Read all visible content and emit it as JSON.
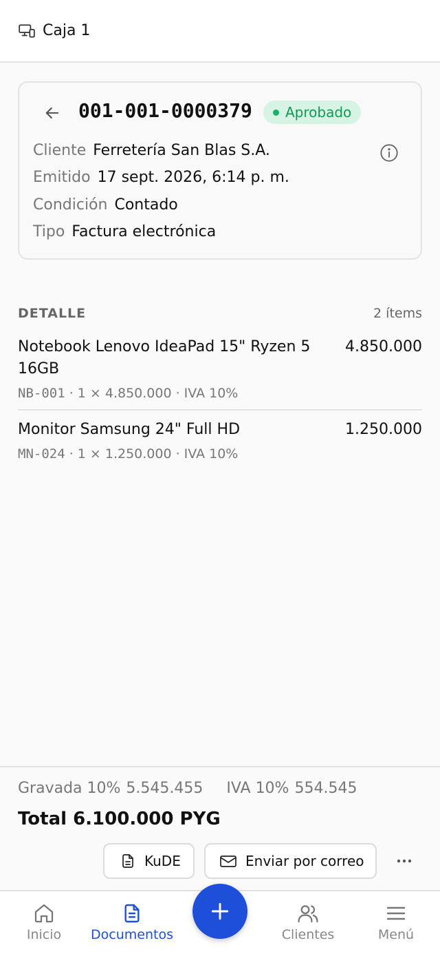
{
  "header": {
    "title": "Caja 1",
    "icon": "devices-icon"
  },
  "document": {
    "number": "001-001-0000379",
    "status": "Aprobado",
    "status_color": "#0f9a55",
    "fields": [
      {
        "label": "Cliente",
        "value": "Ferretería San Blas S.A."
      },
      {
        "label": "Emitido",
        "value": "17 sept. 2026, 6:14 p. m."
      },
      {
        "label": "Condición",
        "value": "Contado"
      },
      {
        "label": "Tipo",
        "value": "Factura electrónica"
      }
    ]
  },
  "detail": {
    "heading": "DETALLE",
    "count": "2 ítems",
    "items": [
      {
        "name": "Notebook Lenovo IdeaPad 15\" Ryzen 5 16GB",
        "amount": "4.850.000",
        "sku": "NB-001",
        "qty_line": "1 × 4.850.000 · IVA 10%"
      },
      {
        "name": "Monitor Samsung 24\" Full HD",
        "amount": "1.250.000",
        "sku": "MN-024",
        "qty_line": "1 × 1.250.000 · IVA 10%"
      }
    ]
  },
  "totals": {
    "gravada_label": "Gravada 10%",
    "gravada_value": "5.545.455",
    "iva_label": "IVA 10%",
    "iva_value": "554.545",
    "total": "Total 6.100.000 PYG"
  },
  "actions": {
    "kude": "KuDE",
    "email": "Enviar por correo"
  },
  "nav": {
    "tabs": [
      {
        "label": "Inicio",
        "icon": "home-icon"
      },
      {
        "label": "Documentos",
        "icon": "document-icon"
      },
      {
        "label": "Clientes",
        "icon": "users-icon"
      },
      {
        "label": "Menú",
        "icon": "menu-icon"
      }
    ],
    "active_color": "#1e4fd8",
    "fab_color": "#1d4fd9"
  }
}
